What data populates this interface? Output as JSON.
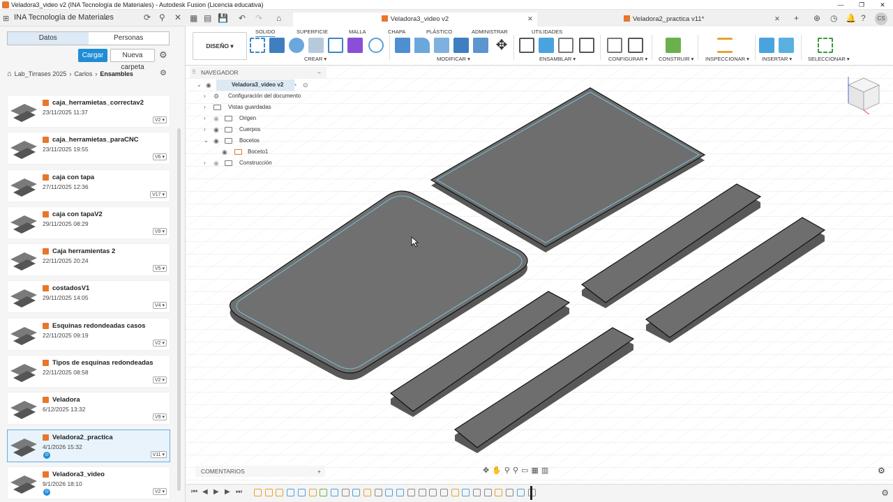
{
  "window": {
    "title": "Veladora3_video v2 (INA Tecnología de Materiales) - Autodesk Fusion (Licencia educativa)"
  },
  "left": {
    "team": "INA Tecnología de Materiales",
    "tabs": [
      "Datos",
      "Personas"
    ],
    "upload": "Cargar",
    "new_folder": "Nueva carpeta",
    "breadcrumb": [
      "Lab_Tirrases 2025",
      "Carlos",
      "Ensambles"
    ],
    "files": [
      {
        "name": "caja_herramietas_correctav2",
        "date": "23/11/2025 11:37",
        "ver": "V2"
      },
      {
        "name": "caja_herramietas_paraCNC",
        "date": "23/11/2025 19:55",
        "ver": "V6"
      },
      {
        "name": "caja con tapa",
        "date": "27/11/2025 12:36",
        "ver": "V17"
      },
      {
        "name": "caja con tapaV2",
        "date": "29/11/2025 08:29",
        "ver": "V9"
      },
      {
        "name": "Caja herramientas 2",
        "date": "22/11/2025 20:24",
        "ver": "V5"
      },
      {
        "name": "costadosV1",
        "date": "29/11/2025 14:05",
        "ver": "V4"
      },
      {
        "name": "Esquinas redondeadas casos",
        "date": "22/11/2025 09:19",
        "ver": "V2"
      },
      {
        "name": "Tipos de esquinas redondeadas",
        "date": "22/11/2025 08:58",
        "ver": "V2"
      },
      {
        "name": "Veladora",
        "date": "6/12/2025 13:32",
        "ver": "V9"
      },
      {
        "name": "Veladora2_practica",
        "date": "4/1/2026 15:32",
        "ver": "V11"
      },
      {
        "name": "Veladora3_video",
        "date": "9/1/2026 18:10",
        "ver": "V2"
      }
    ]
  },
  "doc_tabs": [
    "Veladora3_video v2",
    "Veladora2_practica v11*"
  ],
  "ribbon": {
    "workspace": "DISEÑO",
    "tabs": [
      "SOLIDO",
      "SUPERFICIE",
      "MALLA",
      "CHAPA",
      "PLÁSTICO",
      "ADMINISTRAR",
      "UTILIDADES"
    ],
    "groups": [
      "CREAR",
      "MODIFICAR",
      "ENSAMBLAR",
      "CONFIGURAR",
      "CONSTRUIR",
      "INSPECCIONAR",
      "INSERTAR",
      "SELECCIONAR"
    ]
  },
  "browser": {
    "title": "NAVEGADOR",
    "root": "Veladora3_video v2",
    "items": [
      "Configuración del documento",
      "Vistas guardadas",
      "Origen",
      "Cuerpos",
      "Bocetos",
      "Boceto1",
      "Construcción"
    ]
  },
  "comments": "COMENTARIOS",
  "colors": {
    "accent": "#1f8dd6",
    "part": "#6e6e6e",
    "orange": "#e8762c"
  }
}
